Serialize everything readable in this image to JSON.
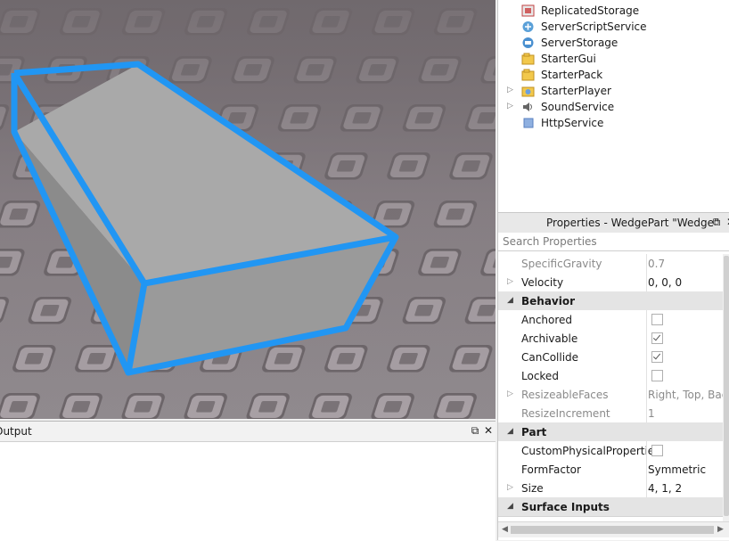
{
  "explorer": {
    "items": [
      {
        "label": "ReplicatedStorage",
        "icon": "replicated-storage-icon",
        "expandable": false
      },
      {
        "label": "ServerScriptService",
        "icon": "server-script-service-icon",
        "expandable": false
      },
      {
        "label": "ServerStorage",
        "icon": "server-storage-icon",
        "expandable": false
      },
      {
        "label": "StarterGui",
        "icon": "starter-gui-icon",
        "expandable": false
      },
      {
        "label": "StarterPack",
        "icon": "starter-pack-icon",
        "expandable": false
      },
      {
        "label": "StarterPlayer",
        "icon": "starter-player-icon",
        "expandable": true
      },
      {
        "label": "SoundService",
        "icon": "sound-service-icon",
        "expandable": true
      },
      {
        "label": "HttpService",
        "icon": "http-service-icon",
        "expandable": false
      }
    ]
  },
  "properties": {
    "title": "Properties - WedgePart \"Wedge\"",
    "search_placeholder": "Search Properties",
    "rows": [
      {
        "kind": "prop",
        "name": "SpecificGravity",
        "value": "0.7",
        "disabled": true
      },
      {
        "kind": "prop",
        "name": "Velocity",
        "value": "0, 0, 0",
        "expandable": true
      },
      {
        "kind": "cat",
        "name": "Behavior"
      },
      {
        "kind": "bool",
        "name": "Anchored",
        "checked": false
      },
      {
        "kind": "bool",
        "name": "Archivable",
        "checked": true
      },
      {
        "kind": "bool",
        "name": "CanCollide",
        "checked": true
      },
      {
        "kind": "bool",
        "name": "Locked",
        "checked": false
      },
      {
        "kind": "prop",
        "name": "ResizeableFaces",
        "value": "Right, Top, Back",
        "disabled": true,
        "expandable": true
      },
      {
        "kind": "prop",
        "name": "ResizeIncrement",
        "value": "1",
        "disabled": true
      },
      {
        "kind": "cat",
        "name": "Part"
      },
      {
        "kind": "bool",
        "name": "CustomPhysicalProperties",
        "checked": false
      },
      {
        "kind": "prop",
        "name": "FormFactor",
        "value": "Symmetric"
      },
      {
        "kind": "prop",
        "name": "Size",
        "value": "4, 1, 2",
        "expandable": true
      },
      {
        "kind": "cat",
        "name": "Surface Inputs"
      }
    ]
  },
  "output": {
    "title": "Output"
  },
  "colors": {
    "selection": "#2196f3",
    "wedge_light": "#a8a8a8",
    "wedge_dark": "#8e8e8e"
  }
}
